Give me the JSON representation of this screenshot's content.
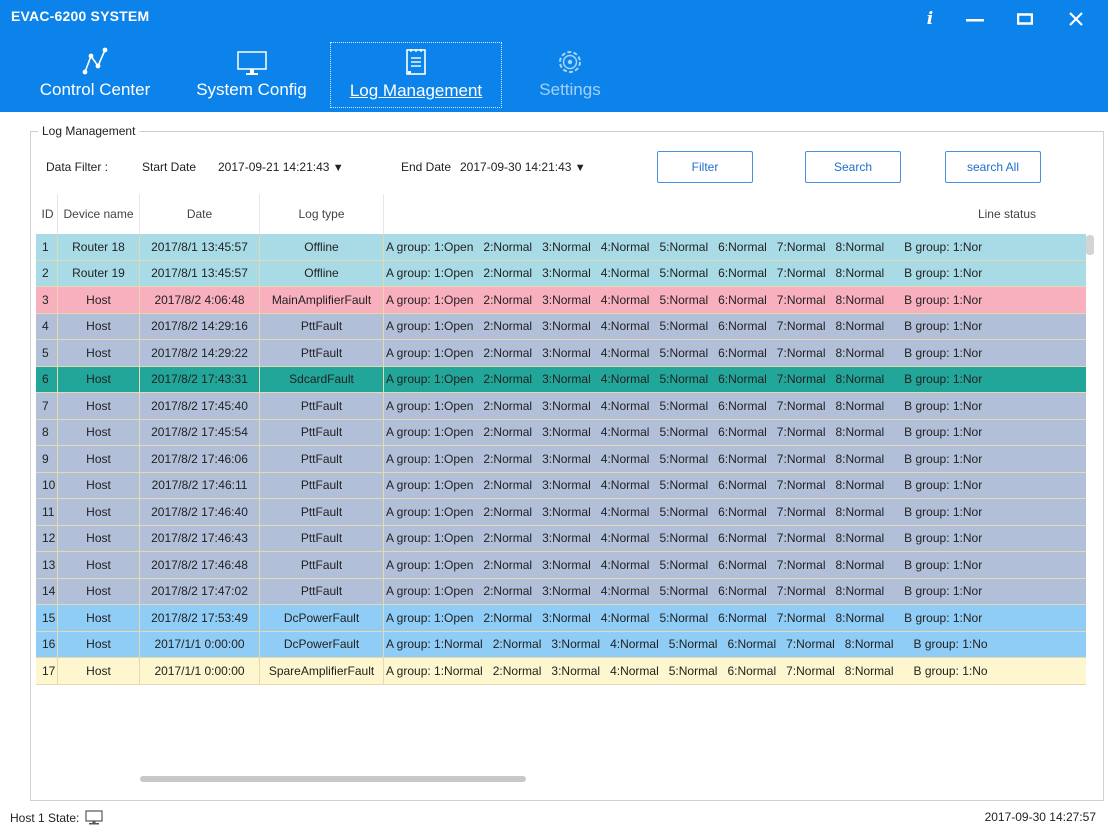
{
  "app": {
    "title": "EVAC-6200 SYSTEM"
  },
  "window_controls": {
    "info": "i"
  },
  "nav": [
    {
      "label": "Control Center",
      "icon": "chart-line-icon",
      "state": "normal"
    },
    {
      "label": "System Config",
      "icon": "monitor-icon",
      "state": "normal"
    },
    {
      "label": "Log Management",
      "icon": "document-icon",
      "state": "active"
    },
    {
      "label": "Settings",
      "icon": "gear-icon",
      "state": "dim"
    }
  ],
  "panel": {
    "title": "Log Management"
  },
  "filter": {
    "label": "Data Filter :",
    "start_label": "Start Date",
    "start_value": "2017-09-21 14:21:43",
    "end_label": "End Date",
    "end_value": "2017-09-30 14:21:43",
    "arrow": "▼",
    "filter_button": "Filter",
    "search_button": "Search",
    "search_all_button": "search All"
  },
  "table": {
    "columns": {
      "id": "ID",
      "device": "Device name",
      "date": "Date",
      "type": "Log type",
      "line": "Line status"
    },
    "rows": [
      {
        "id": "1",
        "device": "Router 18",
        "date": "2017/8/1 13:45:57",
        "type": "Offline",
        "line": "A group: 1:Open   2:Normal   3:Normal   4:Normal   5:Normal   6:Normal   7:Normal   8:Normal      B group: 1:Nor",
        "style": "offline"
      },
      {
        "id": "2",
        "device": "Router 19",
        "date": "2017/8/1 13:45:57",
        "type": "Offline",
        "line": "A group: 1:Open   2:Normal   3:Normal   4:Normal   5:Normal   6:Normal   7:Normal   8:Normal      B group: 1:Nor",
        "style": "offline"
      },
      {
        "id": "3",
        "device": "Host",
        "date": "2017/8/2 4:06:48",
        "type": "MainAmplifierFault",
        "line": "A group: 1:Open   2:Normal   3:Normal   4:Normal   5:Normal   6:Normal   7:Normal   8:Normal      B group: 1:Nor",
        "style": "main"
      },
      {
        "id": "4",
        "device": "Host",
        "date": "2017/8/2 14:29:16",
        "type": "PttFault",
        "line": "A group: 1:Open   2:Normal   3:Normal   4:Normal   5:Normal   6:Normal   7:Normal   8:Normal      B group: 1:Nor",
        "style": "ptt"
      },
      {
        "id": "5",
        "device": "Host",
        "date": "2017/8/2 14:29:22",
        "type": "PttFault",
        "line": "A group: 1:Open   2:Normal   3:Normal   4:Normal   5:Normal   6:Normal   7:Normal   8:Normal      B group: 1:Nor",
        "style": "ptt"
      },
      {
        "id": "6",
        "device": "Host",
        "date": "2017/8/2 17:43:31",
        "type": "SdcardFault",
        "line": "A group: 1:Open   2:Normal   3:Normal   4:Normal   5:Normal   6:Normal   7:Normal   8:Normal      B group: 1:Nor",
        "style": "sd"
      },
      {
        "id": "7",
        "device": "Host",
        "date": "2017/8/2 17:45:40",
        "type": "PttFault",
        "line": "A group: 1:Open   2:Normal   3:Normal   4:Normal   5:Normal   6:Normal   7:Normal   8:Normal      B group: 1:Nor",
        "style": "ptt"
      },
      {
        "id": "8",
        "device": "Host",
        "date": "2017/8/2 17:45:54",
        "type": "PttFault",
        "line": "A group: 1:Open   2:Normal   3:Normal   4:Normal   5:Normal   6:Normal   7:Normal   8:Normal      B group: 1:Nor",
        "style": "ptt"
      },
      {
        "id": "9",
        "device": "Host",
        "date": "2017/8/2 17:46:06",
        "type": "PttFault",
        "line": "A group: 1:Open   2:Normal   3:Normal   4:Normal   5:Normal   6:Normal   7:Normal   8:Normal      B group: 1:Nor",
        "style": "ptt"
      },
      {
        "id": "10",
        "device": "Host",
        "date": "2017/8/2 17:46:11",
        "type": "PttFault",
        "line": "A group: 1:Open   2:Normal   3:Normal   4:Normal   5:Normal   6:Normal   7:Normal   8:Normal      B group: 1:Nor",
        "style": "ptt"
      },
      {
        "id": "11",
        "device": "Host",
        "date": "2017/8/2 17:46:40",
        "type": "PttFault",
        "line": "A group: 1:Open   2:Normal   3:Normal   4:Normal   5:Normal   6:Normal   7:Normal   8:Normal      B group: 1:Nor",
        "style": "ptt"
      },
      {
        "id": "12",
        "device": "Host",
        "date": "2017/8/2 17:46:43",
        "type": "PttFault",
        "line": "A group: 1:Open   2:Normal   3:Normal   4:Normal   5:Normal   6:Normal   7:Normal   8:Normal      B group: 1:Nor",
        "style": "ptt"
      },
      {
        "id": "13",
        "device": "Host",
        "date": "2017/8/2 17:46:48",
        "type": "PttFault",
        "line": "A group: 1:Open   2:Normal   3:Normal   4:Normal   5:Normal   6:Normal   7:Normal   8:Normal      B group: 1:Nor",
        "style": "ptt"
      },
      {
        "id": "14",
        "device": "Host",
        "date": "2017/8/2 17:47:02",
        "type": "PttFault",
        "line": "A group: 1:Open   2:Normal   3:Normal   4:Normal   5:Normal   6:Normal   7:Normal   8:Normal      B group: 1:Nor",
        "style": "ptt"
      },
      {
        "id": "15",
        "device": "Host",
        "date": "2017/8/2 17:53:49",
        "type": "DcPowerFault",
        "line": "A group: 1:Open   2:Normal   3:Normal   4:Normal   5:Normal   6:Normal   7:Normal   8:Normal      B group: 1:Nor",
        "style": "dc"
      },
      {
        "id": "16",
        "device": "Host",
        "date": "2017/1/1 0:00:00",
        "type": "DcPowerFault",
        "line": "A group: 1:Normal   2:Normal   3:Normal   4:Normal   5:Normal   6:Normal   7:Normal   8:Normal      B group: 1:No",
        "style": "dc"
      },
      {
        "id": "17",
        "device": "Host",
        "date": "2017/1/1 0:00:00",
        "type": "SpareAmplifierFault",
        "line": "A group: 1:Normal   2:Normal   3:Normal   4:Normal   5:Normal   6:Normal   7:Normal   8:Normal      B group: 1:No",
        "style": "spare"
      }
    ]
  },
  "status": {
    "host_state_label": "Host 1 State:",
    "host_icon": "monitor-icon",
    "timestamp": "2017-09-30 14:27:57"
  },
  "colors": {
    "titlebar": "#0b83ea",
    "offline": "#a9dbe6",
    "main_amplifier_fault": "#f8b0bf",
    "ptt_fault": "#b2bfd8",
    "sdcard_fault": "#22a69a",
    "dc_power_fault": "#8fcdf6",
    "spare_amplifier_fault": "#fdf6cf"
  }
}
